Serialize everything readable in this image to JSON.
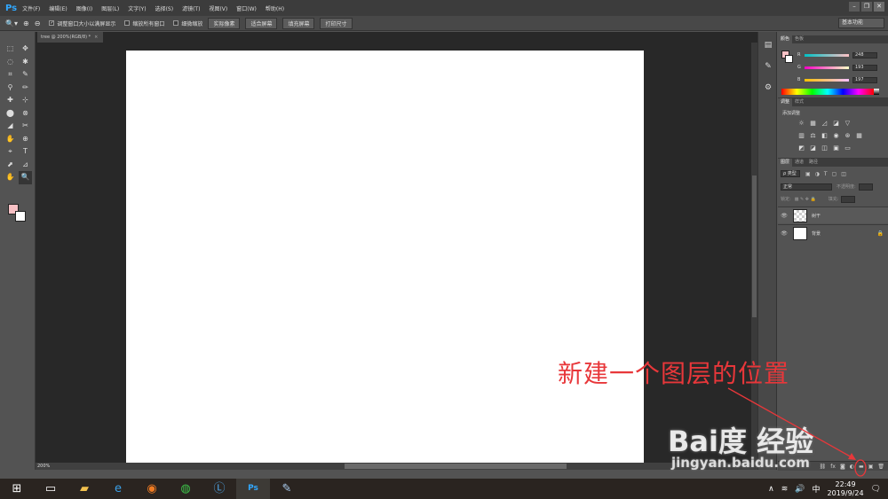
{
  "app": {
    "logo": "Ps",
    "menus": [
      "文件(F)",
      "编辑(E)",
      "图像(I)",
      "图层(L)",
      "文字(Y)",
      "选择(S)",
      "滤镜(T)",
      "视图(V)",
      "窗口(W)",
      "帮助(H)"
    ],
    "window_controls": [
      "–",
      "❐",
      "✕"
    ]
  },
  "options_bar": {
    "zoom_in_icon": "zoom-in",
    "checks": [
      {
        "label": "调整窗口大小以满屏显示",
        "checked": true
      },
      {
        "label": "缩放所有窗口",
        "checked": false
      },
      {
        "label": "细微缩放",
        "checked": false
      }
    ],
    "buttons": [
      "实际像素",
      "适合屏幕",
      "填充屏幕",
      "打印尺寸"
    ],
    "workspace": "基本功能"
  },
  "document": {
    "tab_title": "tree @ 200%(RGB/8) *",
    "tab_close": "×",
    "zoom": "200%"
  },
  "tools": [
    "⬚",
    "✥",
    "◌",
    "✱",
    "⌗",
    "✎",
    "⚲",
    "✏",
    "✚",
    "⊹",
    "⬤",
    "⊗",
    "◢",
    "✂",
    "✋",
    "⊕",
    "⌖",
    "T",
    "⬈",
    "⊿",
    "✋",
    "🔍"
  ],
  "color_panel": {
    "tabs": [
      "颜色",
      "色板"
    ],
    "r_label": "R",
    "r": "248",
    "g_label": "G",
    "g": "193",
    "b_label": "B",
    "b": "197",
    "accent": "#f8c1c5"
  },
  "adjust_panel": {
    "tabs": [
      "调整",
      "样式"
    ],
    "title": "添加调整"
  },
  "layers_panel": {
    "tabs": [
      "图层",
      "通道",
      "路径"
    ],
    "filter": "ρ 类型",
    "blend_mode": "正常",
    "opacity_label": "不透明度:",
    "lock_label": "锁定:",
    "fill_label": "填充:",
    "layers": [
      {
        "name": "树干",
        "thumb": "checker",
        "selected": true
      },
      {
        "name": "背景",
        "thumb": "white",
        "selected": false
      }
    ]
  },
  "annotation": {
    "text": "新建一个图层的位置",
    "color": "#e8373a"
  },
  "watermark": {
    "logo": "Bai度 经验",
    "url": "jingyan.baidu.com"
  },
  "taskbar": {
    "time": "22:49",
    "date": "2019/9/24",
    "ime": "中"
  }
}
